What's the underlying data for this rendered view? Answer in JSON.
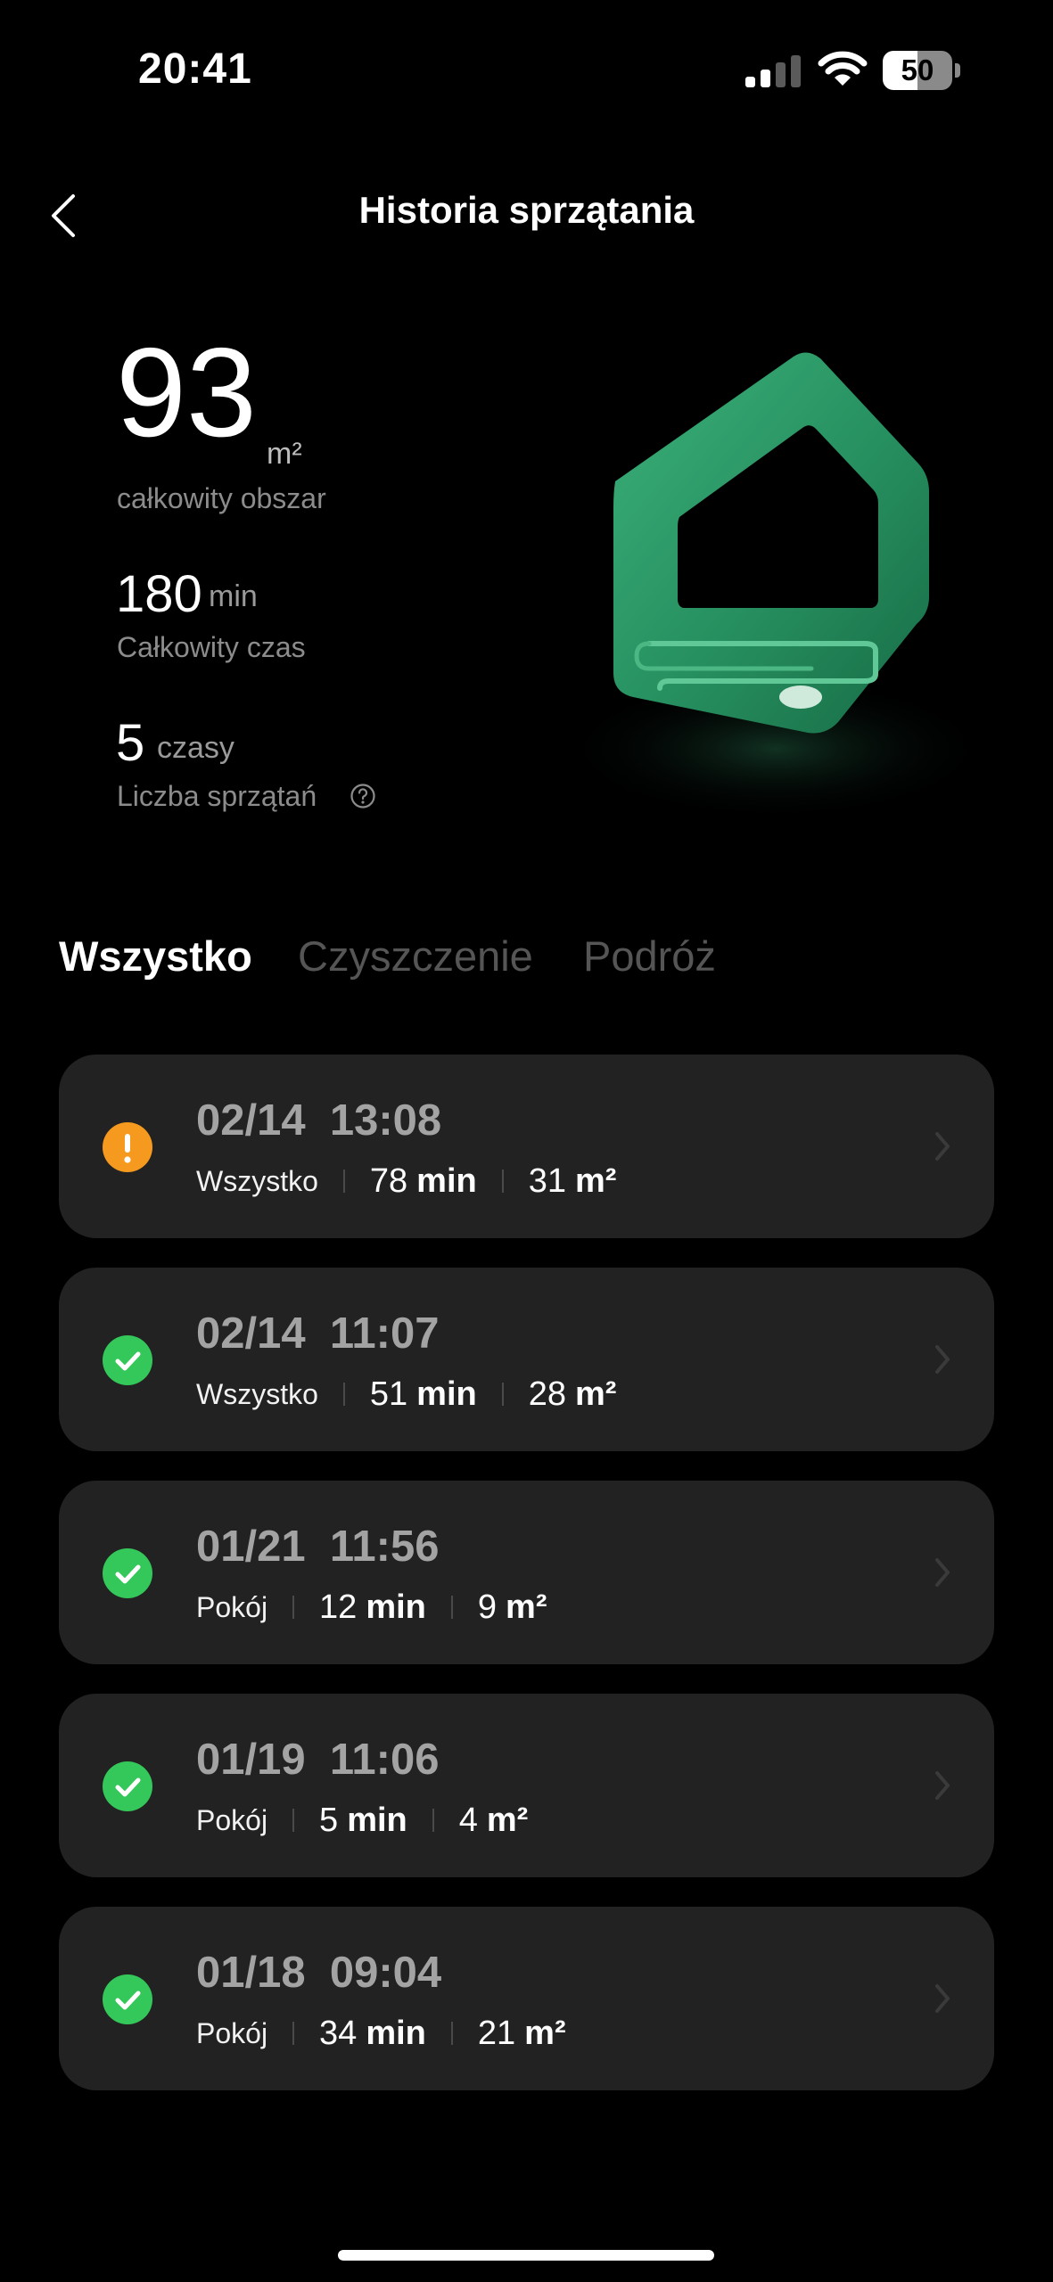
{
  "status_bar": {
    "time": "20:41",
    "battery_level": "50",
    "battery_fraction": 0.5
  },
  "header": {
    "title": "Historia sprzątania",
    "back_icon": "chevron-left-icon"
  },
  "stats": {
    "area_value": "93",
    "area_unit": "m²",
    "area_label": "całkowity obszar",
    "time_value": "180",
    "time_unit": "min",
    "time_label": "Całkowity czas",
    "count_value": "5",
    "count_unit": "czasy",
    "count_label": "Liczba sprzątań",
    "help_icon": "question-circle-icon"
  },
  "colors": {
    "accent_green": "#2f9e6a",
    "success": "#34c759",
    "warning": "#f59a1f",
    "card_bg": "#222222"
  },
  "tabs": [
    {
      "label": "Wszystko",
      "active": true
    },
    {
      "label": "Czyszczenie",
      "active": false
    },
    {
      "label": "Podróż",
      "active": false
    }
  ],
  "records": [
    {
      "date": "02/14",
      "time": "13:08",
      "mode": "Wszystko",
      "duration": "78",
      "duration_unit": "min",
      "area": "31",
      "area_unit": "m²",
      "status": "warning"
    },
    {
      "date": "02/14",
      "time": "11:07",
      "mode": "Wszystko",
      "duration": "51",
      "duration_unit": "min",
      "area": "28",
      "area_unit": "m²",
      "status": "success"
    },
    {
      "date": "01/21",
      "time": "11:56",
      "mode": "Pokój",
      "duration": "12",
      "duration_unit": "min",
      "area": "9",
      "area_unit": "m²",
      "status": "success"
    },
    {
      "date": "01/19",
      "time": "11:06",
      "mode": "Pokój",
      "duration": "5",
      "duration_unit": "min",
      "area": "4",
      "area_unit": "m²",
      "status": "success"
    },
    {
      "date": "01/18",
      "time": "09:04",
      "mode": "Pokój",
      "duration": "34",
      "duration_unit": "min",
      "area": "21",
      "area_unit": "m²",
      "status": "success"
    }
  ]
}
